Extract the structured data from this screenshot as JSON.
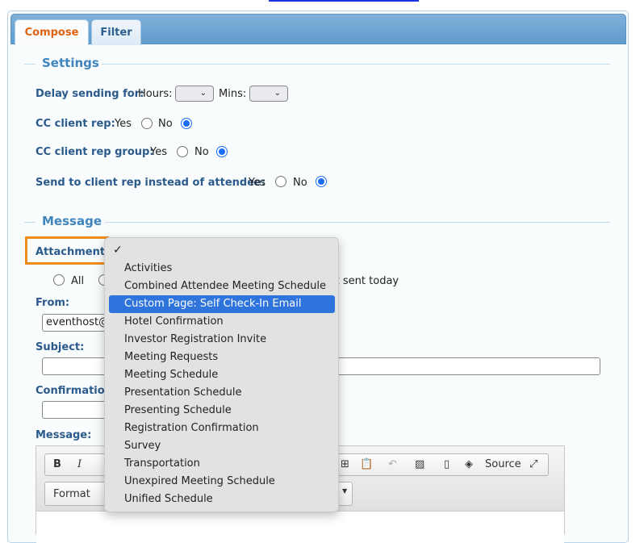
{
  "tabs": [
    {
      "label": "Compose",
      "active": true
    },
    {
      "label": "Filter",
      "active": false
    }
  ],
  "settings": {
    "title": "Settings",
    "delay_label": "Delay sending for:",
    "hours_label": "Hours:",
    "mins_label": "Mins:",
    "cc_rep_label": "CC client rep:",
    "cc_group_label": "CC client rep group:",
    "send_rep_label": "Send to client rep instead of attendee:",
    "yes": "Yes",
    "no": "No"
  },
  "message": {
    "title": "Message",
    "attachment_label": "Attachment:",
    "radio_all": "All",
    "radio_other": "Not sent today",
    "from_label": "From:",
    "from_value": "eventhost@",
    "subject_label": "Subject:",
    "confirmation_label": "Confirmation",
    "message_label": "Message:"
  },
  "editor": {
    "source_label": "Source",
    "format_label": "Format"
  },
  "dropdown": {
    "checked": "✓",
    "items": [
      "Activities",
      "Combined Attendee Meeting Schedule",
      "Custom Page: Self Check-In Email",
      "Hotel Confirmation",
      "Investor Registration Invite",
      "Meeting Requests",
      "Meeting Schedule",
      "Presentation Schedule",
      "Presenting Schedule",
      "Registration Confirmation",
      "Survey",
      "Transportation",
      "Unexpired Meeting Schedule",
      "Unified Schedule"
    ],
    "highlighted_index": 2
  },
  "colors": {
    "accent": "#e0620e",
    "highlight": "#f08c1e",
    "selection": "#2e74dc"
  }
}
